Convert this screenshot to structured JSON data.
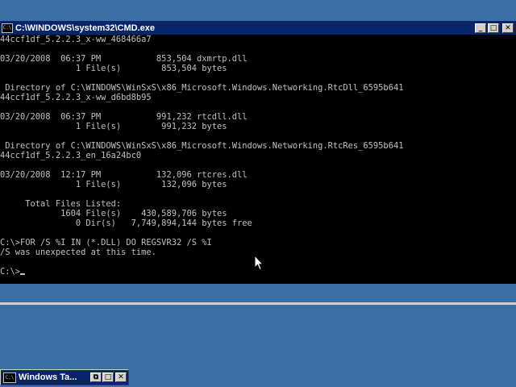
{
  "window": {
    "title": "C:\\WINDOWS\\system32\\CMD.exe",
    "icon_label": "C:\\",
    "minimize_label": "_",
    "maximize_label": "□",
    "close_label": "✕"
  },
  "console": {
    "lines": [
      "44ccf1df_5.2.2.3_x-ww_468466a7",
      "",
      "03/20/2008  06:37 PM           853,504 dxmrtp.dll",
      "               1 File(s)        853,504 bytes",
      "",
      " Directory of C:\\WINDOWS\\WinSxS\\x86_Microsoft.Windows.Networking.RtcDll_6595b641",
      "44ccf1df_5.2.2.3_x-ww_d6bd8b95",
      "",
      "03/20/2008  06:37 PM           991,232 rtcdll.dll",
      "               1 File(s)        991,232 bytes",
      "",
      " Directory of C:\\WINDOWS\\WinSxS\\x86_Microsoft.Windows.Networking.RtcRes_6595b641",
      "44ccf1df_5.2.2.3_en_16a24bc0",
      "",
      "03/20/2008  12:17 PM           132,096 rtcres.dll",
      "               1 File(s)        132,096 bytes",
      "",
      "     Total Files Listed:",
      "            1604 File(s)    430,589,706 bytes",
      "               0 Dir(s)   7,749,894,144 bytes free",
      "",
      "C:\\>FOR /S %I IN (*.DLL) DO REGSVR32 /S %I",
      "/S was unexpected at this time.",
      "",
      "C:\\>"
    ]
  },
  "taskbar_window": {
    "title": "Windows Ta...",
    "icon_label": "C:\\",
    "restore_label": "⧉",
    "maximize_label": "□",
    "close_label": "✕"
  },
  "colors": {
    "desktop": "#3a6ea5",
    "titlebar": "#0a246a",
    "console_bg": "#000000",
    "console_text": "#c0c0c0"
  }
}
